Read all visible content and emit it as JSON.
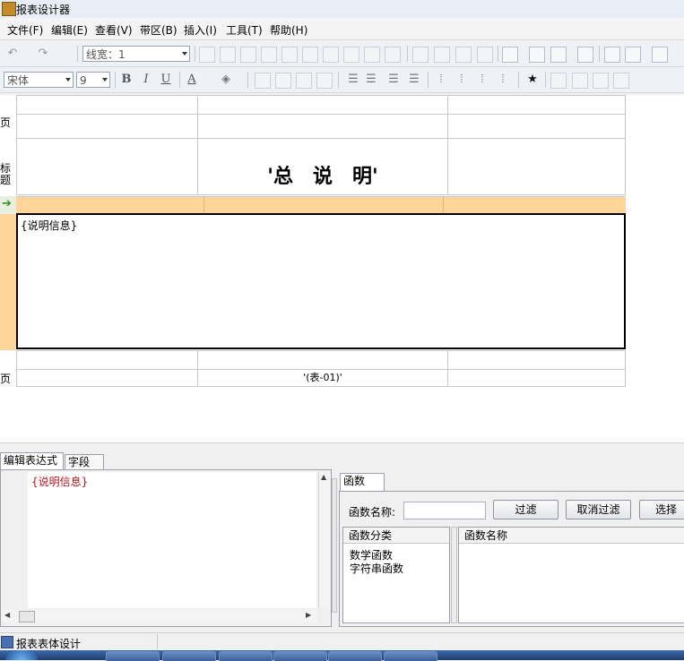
{
  "window": {
    "title": "报表设计器"
  },
  "menu": {
    "items": [
      "文件(F)",
      "编辑(E)",
      "查看(V)",
      "带区(B)",
      "插入(I)",
      "工具(T)",
      "帮助(H)"
    ]
  },
  "toolbar1": {
    "line_width": "线宽：1"
  },
  "toolbar2": {
    "font_name": "宋体",
    "font_size": "9",
    "bold": "B",
    "italic": "I",
    "underline": "U",
    "font_color": "A",
    "star": "★"
  },
  "design": {
    "band_labels": {
      "page_header": "页",
      "title": "标题",
      "page_footer": "页"
    },
    "title_text": "'总　说　明'",
    "detail_text": "{说明信息}",
    "footer_text": "'(表-01)'"
  },
  "bottom": {
    "tabs": [
      "编辑表达式",
      "字段"
    ],
    "expression": "{说明信息}",
    "func_tab": "函数",
    "func_name_label": "函数名称:",
    "func_name_value": "",
    "buttons": {
      "filter": "过滤",
      "cancel_filter": "取消过滤",
      "select": "选择"
    },
    "category_header": "函数分类",
    "categories": [
      "数学函数",
      "字符串函数"
    ],
    "name_header": "函数名称"
  },
  "status": {
    "text": "报表表体设计"
  }
}
